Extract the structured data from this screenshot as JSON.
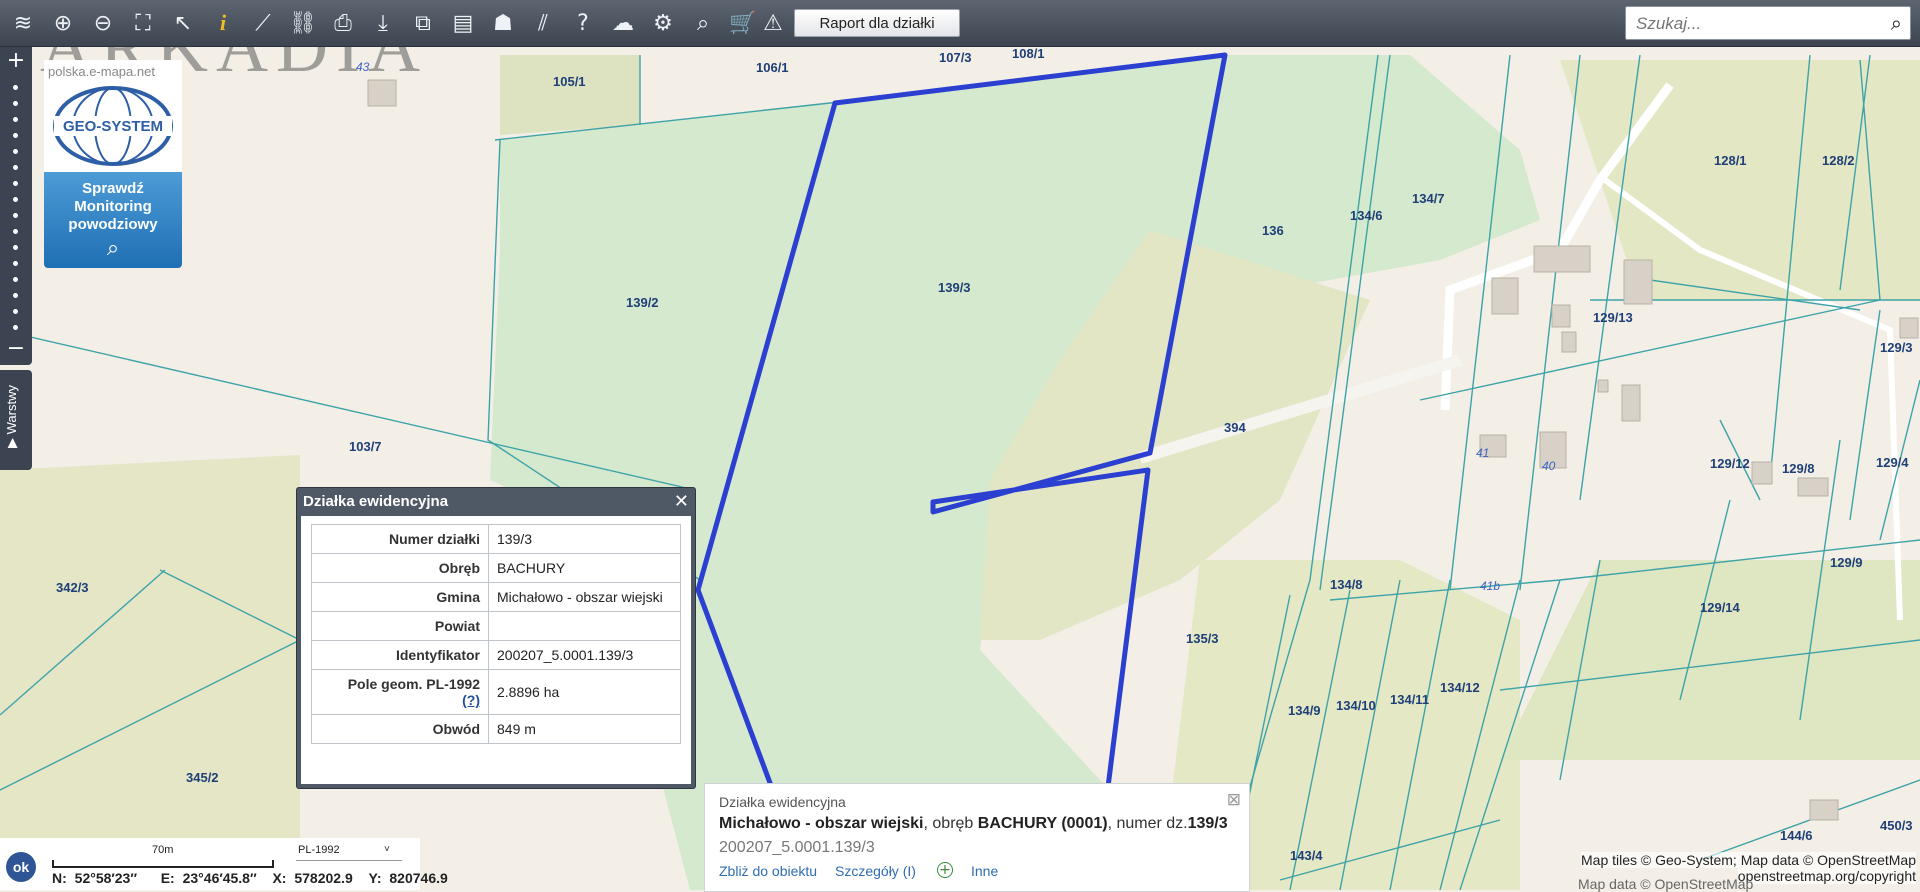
{
  "toolbar": {
    "report_button": "Raport dla działki",
    "search_placeholder": "Szukaj...",
    "tools": [
      "layers-icon",
      "zoom-in-icon",
      "zoom-out-icon",
      "zoom-extent-icon",
      "pointer-icon",
      "info-icon",
      "measure-distance-icon",
      "measure-link-icon",
      "print-icon",
      "download-icon",
      "layer-select-icon",
      "layout-icon",
      "area-icon",
      "hatch-icon",
      "help-icon",
      "cloud-icon",
      "settings-icon",
      "search-map-icon",
      "cart-icon",
      "warning-road-icon"
    ]
  },
  "map": {
    "watermark": "ARKADIA",
    "parcel_labels": [
      "106/1",
      "107/3",
      "108/1",
      "105/1",
      "139/2",
      "139/3",
      "136",
      "134/6",
      "134/7",
      "128/1",
      "128/2",
      "129/13",
      "129/3",
      "394",
      "103/7",
      "129/12",
      "129/8",
      "129/4",
      "134/8",
      "129/9",
      "129/14",
      "342/3",
      "135/3",
      "134/9",
      "134/10",
      "134/11",
      "134/12",
      "345/2",
      "143/4",
      "144/6",
      "450/3"
    ],
    "address_labels": [
      "43",
      "41",
      "40",
      "41b"
    ],
    "zoom_plus": "+",
    "zoom_minus": "−",
    "layers_tab": "▶ Warstwy"
  },
  "promo": {
    "url": "polska.e-mapa.net",
    "logo": "GEO-SYSTEM",
    "line1": "Sprawdź",
    "line2": "Monitoring",
    "line3": "powodziowy"
  },
  "popup": {
    "title": "Działka ewidencyjna",
    "rows": [
      {
        "k": "Numer działki",
        "v": "139/3"
      },
      {
        "k": "Obręb",
        "v": "BACHURY"
      },
      {
        "k": "Gmina",
        "v": "Michałowo - obszar wiejski"
      },
      {
        "k": "Powiat",
        "v": ""
      },
      {
        "k": "Identyfikator",
        "v": "200207_5.0001.139/3"
      },
      {
        "k": "Pole geom. PL-1992",
        "v": "2.8896 ha"
      },
      {
        "k": "Obwód",
        "v": "849 m"
      }
    ],
    "pole_help": "(?)"
  },
  "info": {
    "header": "Działka ewidencyjna",
    "gmina": "Michałowo - obszar wiejski",
    "sep1": ", obręb ",
    "obreb": "BACHURY (0001)",
    "sep2": ", numer dz.",
    "numer": "139/3",
    "identifier": "200207_5.0001.139/3",
    "link_zoom": "Zbliż do obiektu",
    "link_details": "Szczegóły (I)",
    "link_other": "Inne"
  },
  "status": {
    "ok": "ok",
    "scale": "70m",
    "crs": "PL-1992",
    "n": "N: 52°58′23″",
    "e": "E: 23°46′45.8″",
    "x": "X: 578202.9",
    "y": "Y: 820746.9"
  },
  "attribution": {
    "line1": "Map tiles © Geo-System; Map data © OpenStreetMap",
    "line2": "openstreetmap.org/copyright",
    "line3": "Map data © OpenStreetMap"
  },
  "colors": {
    "selected_parcel": "#2b3fd1",
    "parcel_lines": "#3da3a8",
    "forest": "#cfe6c7",
    "meadow": "#e3e7c4",
    "toolbar": "#4a525c"
  }
}
